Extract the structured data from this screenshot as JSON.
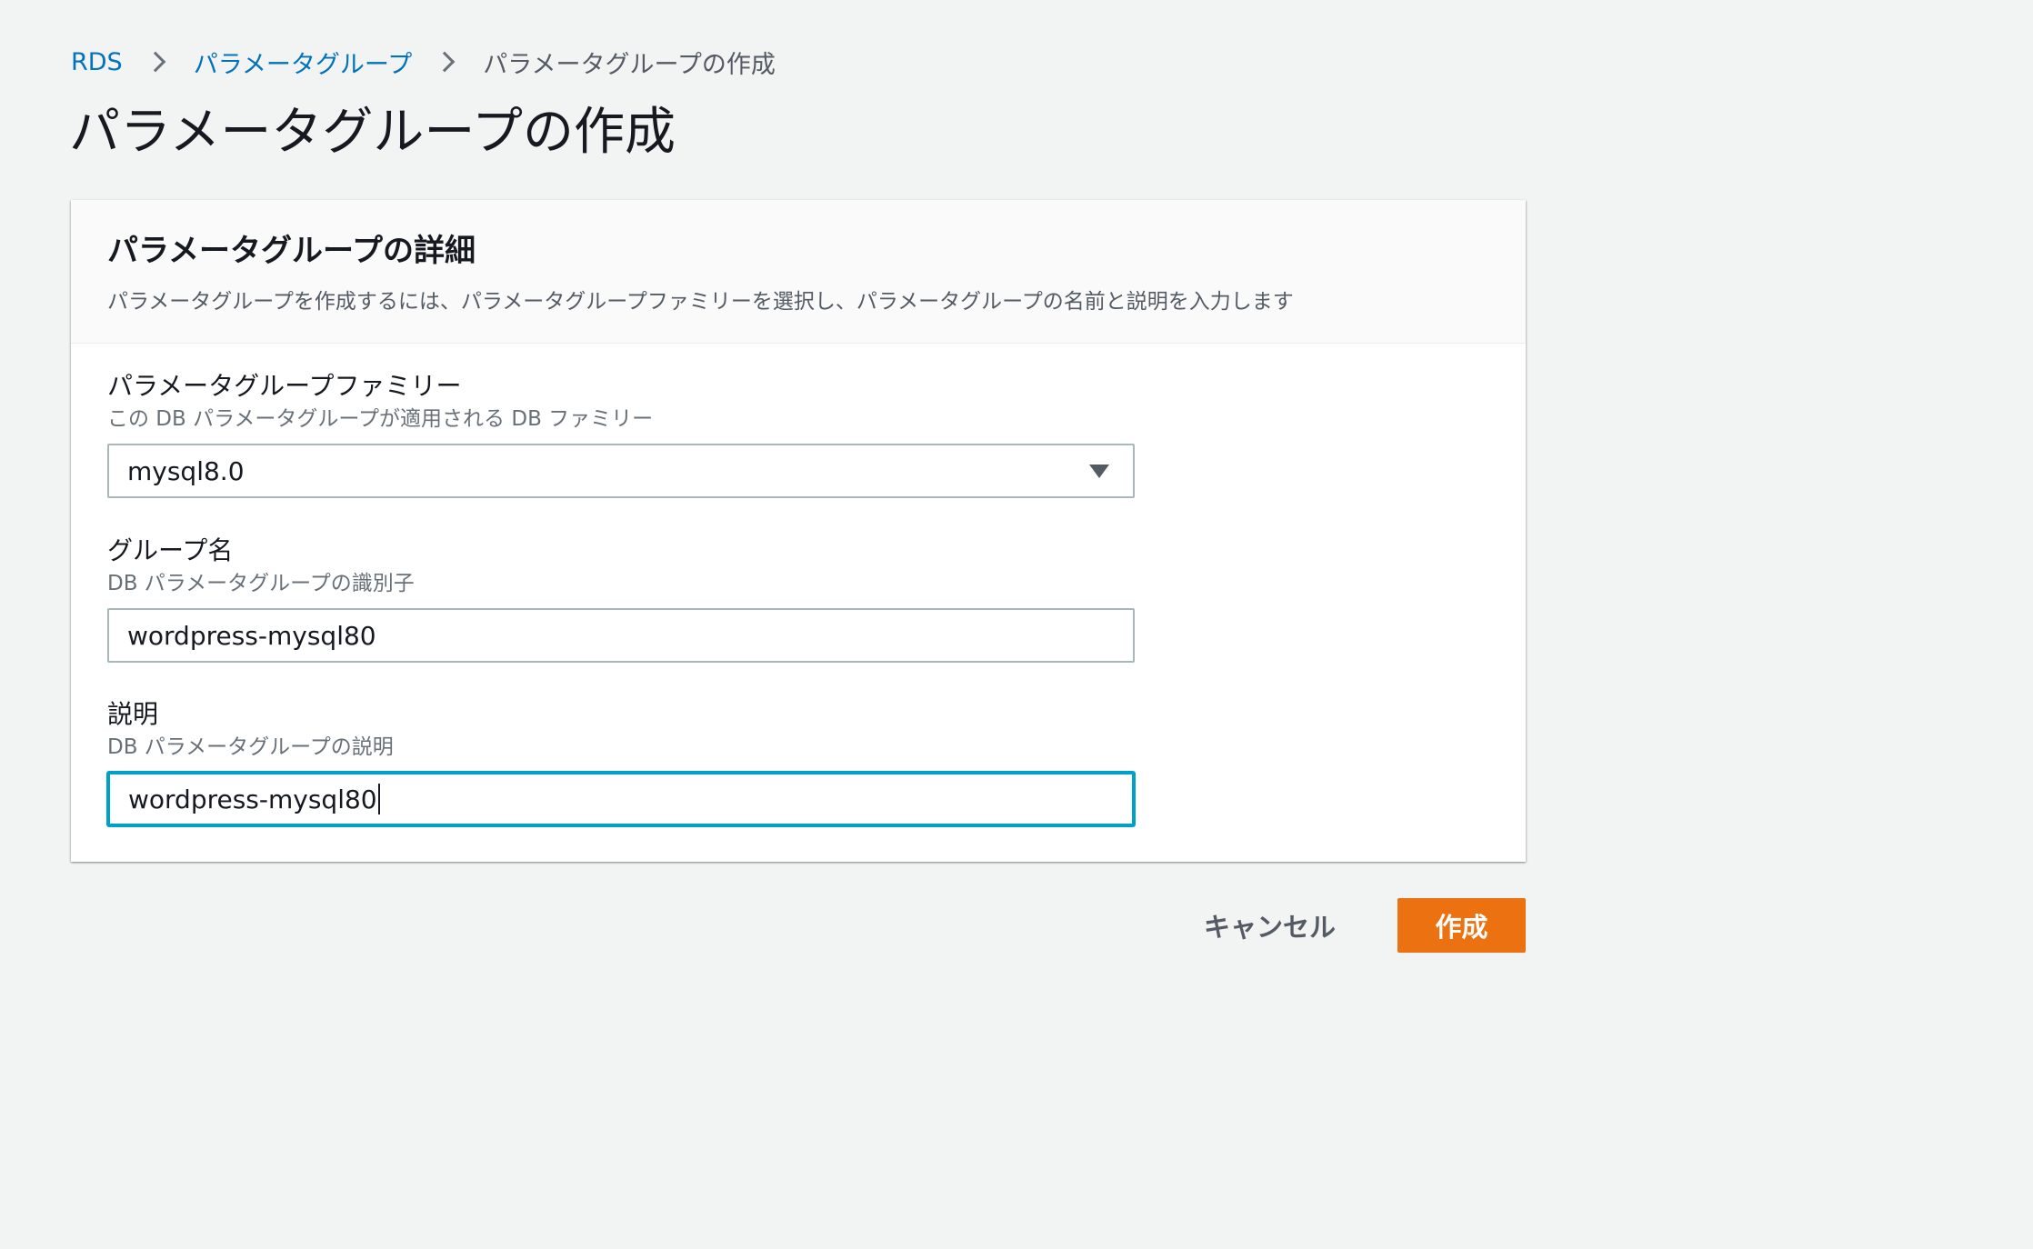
{
  "breadcrumb": {
    "items": [
      "RDS",
      "パラメータグループ",
      "パラメータグループの作成"
    ]
  },
  "page_title": "パラメータグループの作成",
  "panel": {
    "title": "パラメータグループの詳細",
    "description": "パラメータグループを作成するには、パラメータグループファミリーを選択し、パラメータグループの名前と説明を入力します"
  },
  "fields": {
    "family": {
      "label": "パラメータグループファミリー",
      "hint": "この DB パラメータグループが適用される DB ファミリー",
      "value": "mysql8.0"
    },
    "group_name": {
      "label": "グループ名",
      "hint": "DB パラメータグループの識別子",
      "value": "wordpress-mysql80"
    },
    "description": {
      "label": "説明",
      "hint": "DB パラメータグループの説明",
      "value": "wordpress-mysql80"
    }
  },
  "actions": {
    "cancel_label": "キャンセル",
    "create_label": "作成"
  },
  "colors": {
    "link": "#0073bb",
    "primary_button": "#ec7211",
    "focus": "#00a1c9",
    "background": "#f2f3f3"
  },
  "icons": {
    "breadcrumb_separator": "chevron-right-icon",
    "select_caret": "caret-down-icon"
  }
}
